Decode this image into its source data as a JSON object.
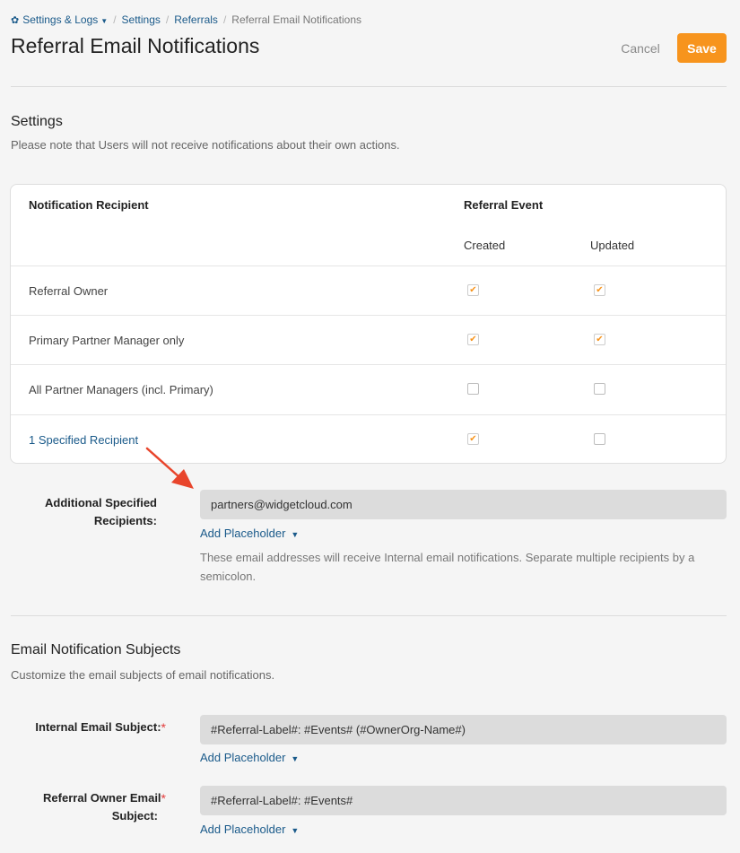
{
  "breadcrumb": {
    "settings_logs": "Settings & Logs",
    "settings": "Settings",
    "referrals": "Referrals",
    "current": "Referral Email Notifications",
    "separator": "/"
  },
  "page_title": "Referral Email Notifications",
  "actions": {
    "cancel_label": "Cancel",
    "save_label": "Save"
  },
  "settings_section": {
    "title": "Settings",
    "description": "Please note that Users will not receive notifications about their own actions."
  },
  "table": {
    "col_recipient": "Notification Recipient",
    "col_event": "Referral Event",
    "sub_created": "Created",
    "sub_updated": "Updated",
    "rows": [
      {
        "label": "Referral Owner",
        "created": true,
        "updated": true
      },
      {
        "label": "Primary Partner Manager only",
        "created": true,
        "updated": true
      },
      {
        "label": "All Partner Managers (incl. Primary)",
        "created": false,
        "updated": false
      },
      {
        "label": "1 Specified Recipient",
        "created": true,
        "updated": false
      }
    ]
  },
  "additional_recipients": {
    "label": "Additional Specified Recipients:",
    "value": "partners@widgetcloud.com",
    "add_placeholder": "Add Placeholder",
    "help": "These email addresses will receive Internal email notifications. Separate multiple recipients by a semicolon."
  },
  "subjects_section": {
    "title": "Email Notification Subjects",
    "description": "Customize the email subjects of email notifications."
  },
  "internal_subject": {
    "label": "Internal Email Subject:",
    "value": "#Referral-Label#: #Events# (#OwnerOrg-Name#)",
    "add_placeholder": "Add Placeholder"
  },
  "owner_subject": {
    "label_line1": "Referral Owner Email",
    "label_line2": "Subject:",
    "value": "#Referral-Label#: #Events#",
    "add_placeholder": "Add Placeholder"
  },
  "required_mark": "*",
  "colors": {
    "accent": "#f7941d",
    "link": "#1a5a8a",
    "annotation_arrow": "#e8452c"
  }
}
